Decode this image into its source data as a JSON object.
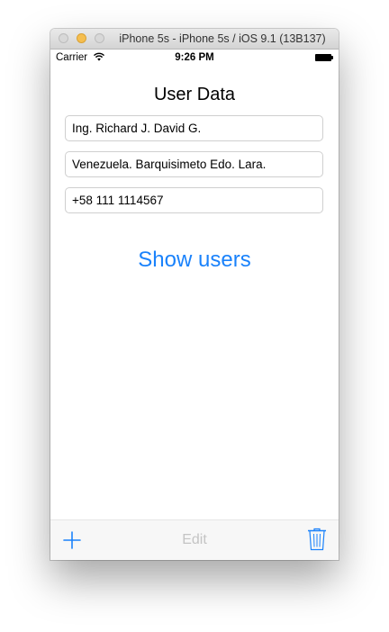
{
  "window": {
    "title": "iPhone 5s - iPhone 5s / iOS 9.1 (13B137)"
  },
  "status_bar": {
    "carrier": "Carrier",
    "time": "9:26 PM",
    "icons": [
      "wifi-icon",
      "battery-icon"
    ]
  },
  "main": {
    "title": "User Data",
    "fields": {
      "name": "Ing. Richard J. David G.",
      "address": "Venezuela. Barquisimeto Edo. Lara.",
      "phone": "+58 111 1114567"
    },
    "show_users_label": "Show users"
  },
  "toolbar": {
    "add_icon": "plus-icon",
    "edit_label": "Edit",
    "trash_icon": "trash-icon"
  },
  "colors": {
    "accent": "#1a82fb",
    "disabled_text": "#c4c4c4",
    "traffic_minimize": "#f5be4f"
  }
}
